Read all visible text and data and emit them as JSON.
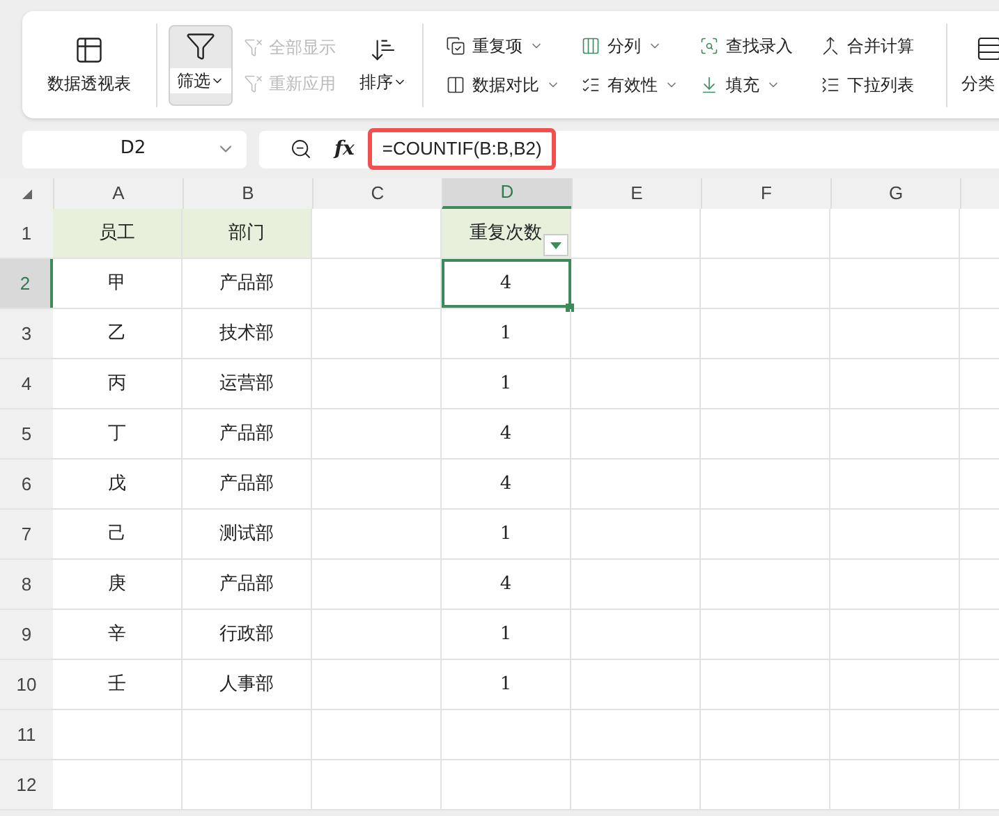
{
  "ribbon": {
    "pivot": {
      "label": "数据透视表"
    },
    "filter": {
      "label": "筛选",
      "pressed": true
    },
    "filter_actions": [
      {
        "label": "全部显示",
        "disabled": true
      },
      {
        "label": "重新应用",
        "disabled": true
      }
    ],
    "sort": {
      "label": "排序"
    },
    "tools": [
      {
        "label": "重复项",
        "dropdown": true,
        "kind": "duplicates"
      },
      {
        "label": "分列",
        "dropdown": true,
        "kind": "split"
      },
      {
        "label": "查找录入",
        "dropdown": false,
        "kind": "lookup"
      },
      {
        "label": "合并计算",
        "dropdown": false,
        "kind": "merge"
      },
      {
        "label": "数据对比",
        "dropdown": true,
        "kind": "compare"
      },
      {
        "label": "有效性",
        "dropdown": true,
        "kind": "validity"
      },
      {
        "label": "填充",
        "dropdown": true,
        "kind": "fill"
      },
      {
        "label": "下拉列表",
        "dropdown": false,
        "kind": "dropdownlist"
      }
    ],
    "classify": {
      "label": "分类"
    }
  },
  "formula_bar": {
    "cell_ref": "D2",
    "fx_label": "fx",
    "formula": "=COUNTIF(B:B,B2)",
    "highlighted": true
  },
  "sheet": {
    "columns": [
      {
        "label": "A",
        "selected": false
      },
      {
        "label": "B",
        "selected": false
      },
      {
        "label": "C",
        "selected": false
      },
      {
        "label": "D",
        "selected": true
      },
      {
        "label": "E",
        "selected": false
      },
      {
        "label": "F",
        "selected": false
      },
      {
        "label": "G",
        "selected": false
      }
    ],
    "rows": [
      {
        "number": "1",
        "selected": false,
        "shaded": true,
        "filter_cells": [
          false,
          false,
          false,
          true
        ],
        "cells": [
          "员工",
          "部门",
          "",
          "重复次数"
        ]
      },
      {
        "number": "2",
        "selected": true,
        "cells": [
          "甲",
          "产品部",
          "",
          "4"
        ]
      },
      {
        "number": "3",
        "selected": false,
        "cells": [
          "乙",
          "技术部",
          "",
          "1"
        ]
      },
      {
        "number": "4",
        "selected": false,
        "cells": [
          "丙",
          "运营部",
          "",
          "1"
        ]
      },
      {
        "number": "5",
        "selected": false,
        "cells": [
          "丁",
          "产品部",
          "",
          "4"
        ]
      },
      {
        "number": "6",
        "selected": false,
        "cells": [
          "戊",
          "产品部",
          "",
          "4"
        ]
      },
      {
        "number": "7",
        "selected": false,
        "cells": [
          "己",
          "测试部",
          "",
          "1"
        ]
      },
      {
        "number": "8",
        "selected": false,
        "cells": [
          "庚",
          "产品部",
          "",
          "4"
        ]
      },
      {
        "number": "9",
        "selected": false,
        "cells": [
          "辛",
          "行政部",
          "",
          "1"
        ]
      },
      {
        "number": "10",
        "selected": false,
        "cells": [
          "壬",
          "人事部",
          "",
          "1"
        ]
      },
      {
        "number": "11",
        "selected": false,
        "cells": []
      },
      {
        "number": "12",
        "selected": false,
        "cells": []
      }
    ]
  }
}
